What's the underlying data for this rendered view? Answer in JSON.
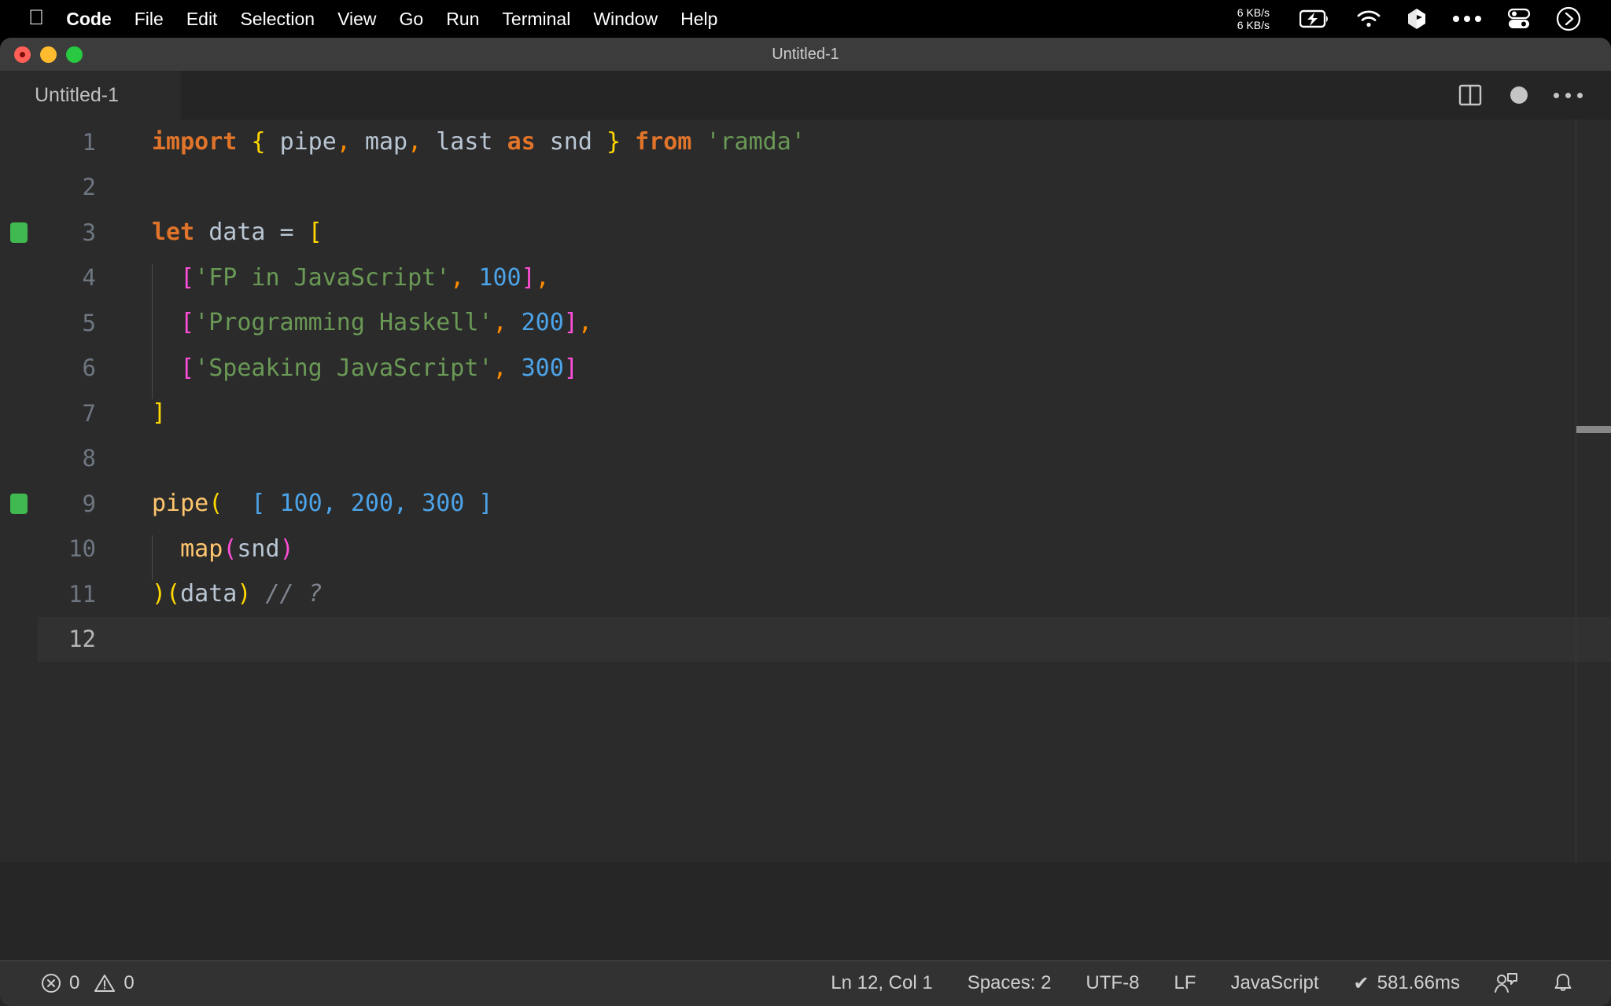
{
  "menubar": {
    "apple_icon": "apple-logo-icon",
    "items": [
      {
        "label": "Code",
        "bold": true
      },
      {
        "label": "File",
        "bold": false
      },
      {
        "label": "Edit",
        "bold": false
      },
      {
        "label": "Selection",
        "bold": false
      },
      {
        "label": "View",
        "bold": false
      },
      {
        "label": "Go",
        "bold": false
      },
      {
        "label": "Run",
        "bold": false
      },
      {
        "label": "Terminal",
        "bold": false
      },
      {
        "label": "Window",
        "bold": false
      },
      {
        "label": "Help",
        "bold": false
      }
    ],
    "tray": {
      "network_speed": "6 KB/s\n6 KB/s",
      "icons": [
        "battery-charging-icon",
        "wifi-icon",
        "dropbox-icon",
        "ellipsis-icon",
        "control-center-icon",
        "siri-icon"
      ]
    }
  },
  "window": {
    "title": "Untitled-1"
  },
  "tabs": {
    "active": "Untitled-1",
    "actions": [
      "split-editor-icon",
      "unsaved-dot-icon",
      "more-actions-icon"
    ]
  },
  "editor": {
    "lines": [
      {
        "number": "1",
        "git": false,
        "indent_guide": false,
        "tokens": [
          {
            "t": "import",
            "c": "kw"
          },
          {
            "t": " ",
            "c": "op"
          },
          {
            "t": "{",
            "c": "brc"
          },
          {
            "t": " ",
            "c": "op"
          },
          {
            "t": "pipe",
            "c": "id"
          },
          {
            "t": ",",
            "c": "com"
          },
          {
            "t": " ",
            "c": "op"
          },
          {
            "t": "map",
            "c": "id"
          },
          {
            "t": ",",
            "c": "com"
          },
          {
            "t": " ",
            "c": "op"
          },
          {
            "t": "last",
            "c": "id"
          },
          {
            "t": " ",
            "c": "op"
          },
          {
            "t": "as",
            "c": "kw"
          },
          {
            "t": " ",
            "c": "op"
          },
          {
            "t": "snd",
            "c": "id"
          },
          {
            "t": " ",
            "c": "op"
          },
          {
            "t": "}",
            "c": "brc"
          },
          {
            "t": " ",
            "c": "op"
          },
          {
            "t": "from",
            "c": "kw"
          },
          {
            "t": " ",
            "c": "op"
          },
          {
            "t": "'ramda'",
            "c": "str"
          }
        ]
      },
      {
        "number": "2",
        "git": false,
        "indent_guide": false,
        "tokens": []
      },
      {
        "number": "3",
        "git": true,
        "indent_guide": false,
        "tokens": [
          {
            "t": "let",
            "c": "kw"
          },
          {
            "t": " ",
            "c": "op"
          },
          {
            "t": "data",
            "c": "id"
          },
          {
            "t": " = ",
            "c": "op"
          },
          {
            "t": "[",
            "c": "brc"
          }
        ]
      },
      {
        "number": "4",
        "git": false,
        "indent_guide": true,
        "tokens": [
          {
            "t": "  ",
            "c": "op"
          },
          {
            "t": "[",
            "c": "brc2"
          },
          {
            "t": "'FP in JavaScript'",
            "c": "str"
          },
          {
            "t": ",",
            "c": "com"
          },
          {
            "t": " ",
            "c": "op"
          },
          {
            "t": "100",
            "c": "num"
          },
          {
            "t": "]",
            "c": "brc2"
          },
          {
            "t": ",",
            "c": "com"
          }
        ]
      },
      {
        "number": "5",
        "git": false,
        "indent_guide": true,
        "tokens": [
          {
            "t": "  ",
            "c": "op"
          },
          {
            "t": "[",
            "c": "brc2"
          },
          {
            "t": "'Programming Haskell'",
            "c": "str"
          },
          {
            "t": ",",
            "c": "com"
          },
          {
            "t": " ",
            "c": "op"
          },
          {
            "t": "200",
            "c": "num"
          },
          {
            "t": "]",
            "c": "brc2"
          },
          {
            "t": ",",
            "c": "com"
          }
        ]
      },
      {
        "number": "6",
        "git": false,
        "indent_guide": true,
        "tokens": [
          {
            "t": "  ",
            "c": "op"
          },
          {
            "t": "[",
            "c": "brc2"
          },
          {
            "t": "'Speaking JavaScript'",
            "c": "str"
          },
          {
            "t": ",",
            "c": "com"
          },
          {
            "t": " ",
            "c": "op"
          },
          {
            "t": "300",
            "c": "num"
          },
          {
            "t": "]",
            "c": "brc2"
          }
        ]
      },
      {
        "number": "7",
        "git": false,
        "indent_guide": false,
        "tokens": [
          {
            "t": "]",
            "c": "brc"
          }
        ]
      },
      {
        "number": "8",
        "git": false,
        "indent_guide": false,
        "tokens": []
      },
      {
        "number": "9",
        "git": true,
        "indent_guide": false,
        "tokens": [
          {
            "t": "pipe",
            "c": "fn"
          },
          {
            "t": "(",
            "c": "brc"
          },
          {
            "t": "  [ 100, 200, 300 ]",
            "c": "hint"
          }
        ]
      },
      {
        "number": "10",
        "git": false,
        "indent_guide": true,
        "tokens": [
          {
            "t": "  ",
            "c": "op"
          },
          {
            "t": "map",
            "c": "fn"
          },
          {
            "t": "(",
            "c": "brc2"
          },
          {
            "t": "snd",
            "c": "id"
          },
          {
            "t": ")",
            "c": "brc2"
          }
        ]
      },
      {
        "number": "11",
        "git": false,
        "indent_guide": false,
        "tokens": [
          {
            "t": ")",
            "c": "brc"
          },
          {
            "t": "(",
            "c": "brc"
          },
          {
            "t": "data",
            "c": "id"
          },
          {
            "t": ")",
            "c": "brc"
          },
          {
            "t": " ",
            "c": "op"
          },
          {
            "t": "// ?",
            "c": "cmt"
          }
        ]
      },
      {
        "number": "12",
        "git": false,
        "indent_guide": false,
        "active": true,
        "tokens": []
      }
    ]
  },
  "statusbar": {
    "errors": "0",
    "warnings": "0",
    "cursor": "Ln 12, Col 1",
    "indentation": "Spaces: 2",
    "encoding": "UTF-8",
    "eol": "LF",
    "language": "JavaScript",
    "timing": "581.66ms",
    "timing_prefix": "✔",
    "right_icons": [
      "feedback-icon",
      "notifications-bell-icon"
    ]
  }
}
